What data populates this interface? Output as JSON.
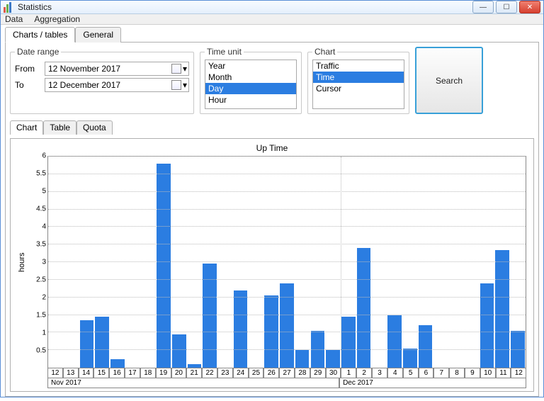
{
  "window": {
    "title": "Statistics"
  },
  "menu": {
    "data": "Data",
    "aggregation": "Aggregation"
  },
  "main_tabs": {
    "charts_tables": "Charts / tables",
    "general": "General"
  },
  "date_range": {
    "legend": "Date range",
    "from_label": "From",
    "to_label": "To",
    "from_value": "12 November 2017",
    "to_value": "12 December 2017"
  },
  "time_unit": {
    "legend": "Time unit",
    "options": [
      "Year",
      "Month",
      "Day",
      "Hour"
    ],
    "selected": "Day"
  },
  "chart_select": {
    "legend": "Chart",
    "options": [
      "Traffic",
      "Time",
      "Cursor"
    ],
    "selected": "Time"
  },
  "search_label": "Search",
  "sub_tabs": {
    "chart": "Chart",
    "table": "Table",
    "quota": "Quota"
  },
  "chart_data": {
    "type": "bar",
    "title": "Up Time",
    "ylabel": "hours",
    "xlabel": "",
    "ylim": [
      0,
      6
    ],
    "yticks": [
      0.5,
      1,
      1.5,
      2,
      2.5,
      3,
      3.5,
      4,
      4.5,
      5,
      5.5,
      6
    ],
    "categories": [
      "12",
      "13",
      "14",
      "15",
      "16",
      "17",
      "18",
      "19",
      "20",
      "21",
      "22",
      "23",
      "24",
      "25",
      "26",
      "27",
      "28",
      "29",
      "30",
      "1",
      "2",
      "3",
      "4",
      "5",
      "6",
      "7",
      "8",
      "9",
      "10",
      "11",
      "12"
    ],
    "values": [
      0,
      0,
      1.35,
      1.45,
      0.25,
      0,
      0,
      5.8,
      0.95,
      0.1,
      2.95,
      0,
      2.2,
      0,
      2.05,
      2.4,
      0.5,
      1.05,
      0.5,
      1.45,
      3.4,
      0,
      1.5,
      0.55,
      1.2,
      0,
      0,
      0,
      2.4,
      3.35,
      1.05
    ],
    "month_split_index": 19,
    "month_labels": [
      "Nov 2017",
      "Dec 2017"
    ]
  }
}
